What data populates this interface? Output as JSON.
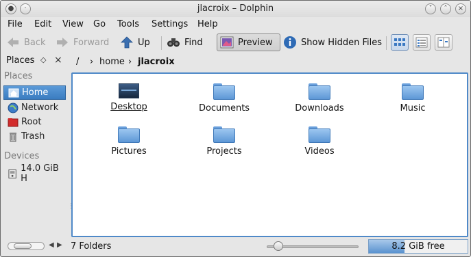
{
  "window": {
    "title": "jlacroix – Dolphin"
  },
  "menu": [
    "File",
    "Edit",
    "View",
    "Go",
    "Tools",
    "Settings",
    "Help"
  ],
  "toolbar": {
    "back": "Back",
    "forward": "Forward",
    "up": "Up",
    "find": "Find",
    "preview": "Preview",
    "show_hidden": "Show Hidden Files"
  },
  "places": {
    "title": "Places",
    "section_places": "Places",
    "items": [
      "Home",
      "Network",
      "Root",
      "Trash"
    ],
    "section_devices": "Devices",
    "devices": [
      "14.0 GiB H"
    ]
  },
  "breadcrumb": {
    "root": "/",
    "home": "home",
    "current": "jlacroix"
  },
  "items": [
    "Desktop",
    "Documents",
    "Downloads",
    "Music",
    "Pictures",
    "Projects",
    "Videos"
  ],
  "status": {
    "folders": "7 Folders",
    "free": "8.2 GiB free",
    "used_fraction": 0.36
  },
  "colors": {
    "accent": "#3a7cc0",
    "folder": "#6aa0dc"
  }
}
